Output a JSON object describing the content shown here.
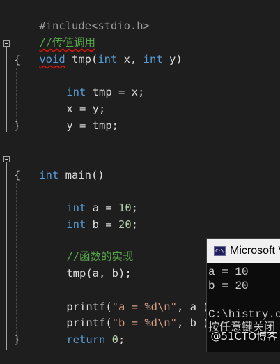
{
  "editor": {
    "include": "#include<stdio.h>",
    "comment_swap": "//传值调用",
    "swap_func": {
      "ret": "void",
      "name": "tmp",
      "paren_open": "(",
      "p1_type": "int",
      "p1_name": " x, ",
      "p2_type": "int",
      "p2_name": " y)",
      "open_brace": "{",
      "decl_type": "int",
      "decl_rest": " tmp = x;",
      "assign1": "x = y;",
      "assign2": "y = tmp;",
      "close_brace": "}"
    },
    "main_func": {
      "ret": "int",
      "name": " main()",
      "open_brace": "{",
      "a_type": "int",
      "a_name": " a = ",
      "a_val": "10",
      "a_end": ";",
      "b_type": "int",
      "b_name": " b = ",
      "b_val": "20",
      "b_end": ";",
      "comment_impl": "//函数的实现",
      "call": "tmp(a, b);",
      "printf1_fn": "printf(",
      "printf1_str": "\"a = %d\\n\"",
      "printf1_rest": ", a );",
      "printf2_fn": "printf(",
      "printf2_str": "\"b = %d\\n\"",
      "printf2_rest": ", b );",
      "return_kw": "return",
      "return_val": " 0",
      "return_end": ";",
      "close_brace": "}"
    }
  },
  "console": {
    "title": "Microsoft Visual Studio 调试控制台",
    "icon_label": "C:\\",
    "lines": [
      "a = 10",
      "b = 20",
      "",
      "C:\\histry.c",
      "按任意键关闭"
    ]
  },
  "watermark": "@51CTO博客",
  "colors": {
    "background": "#1e1e1e",
    "keyword": "#569cd6",
    "comment": "#57a64a",
    "number": "#b5cea8",
    "string": "#d69d85",
    "error_squiggle": "#e51400"
  }
}
